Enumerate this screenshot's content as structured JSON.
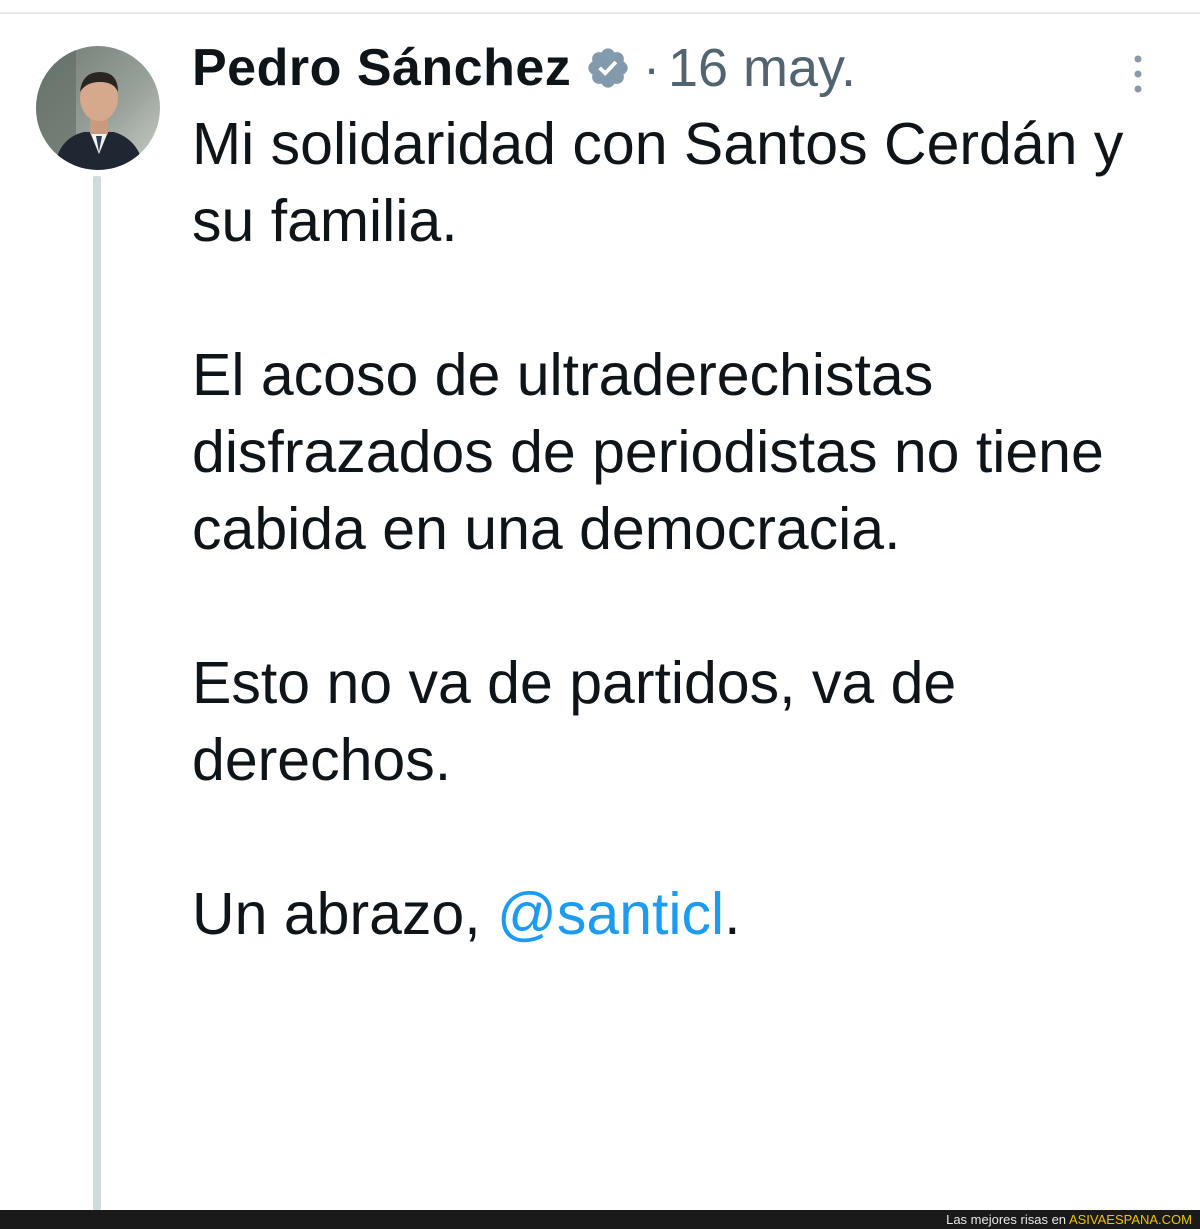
{
  "tweet": {
    "author": {
      "name": "Pedro Sánchez",
      "verified": true
    },
    "separator": "·",
    "date": "16 may.",
    "paragraphs": [
      "Mi solidaridad con Santos Cerdán y su familia.",
      "El acoso de ultraderechistas disfrazados de periodistas no tiene cabida en una democracia.",
      "Esto no va de partidos, va de derechos."
    ],
    "closing": {
      "prefix": "Un abrazo, ",
      "mention": "@santicl",
      "suffix": "."
    }
  },
  "footer": {
    "tagline": "Las mejores risas en ",
    "brand": "ASIVAESPANA.COM"
  },
  "icons": {
    "verified": "verified-badge-icon",
    "more": "more-options-icon",
    "avatar": "profile-photo"
  },
  "colors": {
    "text": "#0f1419",
    "muted": "#536471",
    "link": "#1d9bf0",
    "thread_line": "#cfd9de",
    "footer_bg": "#1a1a1a",
    "footer_brand": "#f2c200"
  }
}
